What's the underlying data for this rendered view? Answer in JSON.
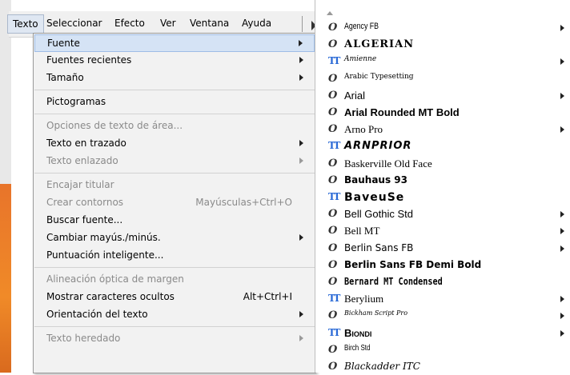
{
  "menubar": {
    "items": [
      "Texto",
      "Seleccionar",
      "Efecto",
      "Ver",
      "Ventana",
      "Ayuda"
    ]
  },
  "menu": {
    "items": [
      {
        "label": "Fuente",
        "shortcut": "",
        "submenu": true,
        "disabled": false,
        "highlight": true
      },
      {
        "label": "Fuentes recientes",
        "shortcut": "",
        "submenu": true,
        "disabled": false
      },
      {
        "label": "Tamaño",
        "shortcut": "",
        "submenu": true,
        "disabled": false
      },
      {
        "separator": true
      },
      {
        "label": "Pictogramas",
        "shortcut": "",
        "submenu": false,
        "disabled": false
      },
      {
        "separator": true
      },
      {
        "label": "Opciones de texto de área...",
        "shortcut": "",
        "submenu": false,
        "disabled": true
      },
      {
        "label": "Texto en trazado",
        "shortcut": "",
        "submenu": true,
        "disabled": false
      },
      {
        "label": "Texto enlazado",
        "shortcut": "",
        "submenu": true,
        "disabled": true
      },
      {
        "separator": true
      },
      {
        "label": "Encajar titular",
        "shortcut": "",
        "submenu": false,
        "disabled": true
      },
      {
        "label": "Crear contornos",
        "shortcut": "Mayúsculas+Ctrl+O",
        "submenu": false,
        "disabled": true
      },
      {
        "label": "Buscar fuente...",
        "shortcut": "",
        "submenu": false,
        "disabled": false
      },
      {
        "label": "Cambiar mayús./minús.",
        "shortcut": "",
        "submenu": true,
        "disabled": false
      },
      {
        "label": "Puntuación inteligente...",
        "shortcut": "",
        "submenu": false,
        "disabled": false
      },
      {
        "separator": true
      },
      {
        "label": "Alineación óptica de margen",
        "shortcut": "",
        "submenu": false,
        "disabled": true
      },
      {
        "label": "Mostrar caracteres ocultos",
        "shortcut": "Alt+Ctrl+I",
        "submenu": false,
        "disabled": false
      },
      {
        "label": "Orientación del texto",
        "shortcut": "",
        "submenu": true,
        "disabled": false
      },
      {
        "separator": true
      },
      {
        "label": "Texto heredado",
        "shortcut": "",
        "submenu": true,
        "disabled": true
      }
    ]
  },
  "fonts": [
    {
      "name": "Agency FB",
      "icon": "opentype-icon",
      "submenu": true
    },
    {
      "name": "ALGERIAN",
      "icon": "opentype-icon",
      "submenu": false
    },
    {
      "name": "Amienne",
      "icon": "truetype-icon",
      "submenu": true
    },
    {
      "name": "Arabic Typesetting",
      "icon": "opentype-icon",
      "submenu": false
    },
    {
      "name": "Arial",
      "icon": "opentype-icon",
      "submenu": true
    },
    {
      "name": "Arial Rounded MT Bold",
      "icon": "opentype-icon",
      "submenu": false
    },
    {
      "name": "Arno Pro",
      "icon": "opentype-icon",
      "submenu": true
    },
    {
      "name": "ARNPRIOR",
      "icon": "truetype-icon",
      "submenu": false
    },
    {
      "name": "Baskerville Old Face",
      "icon": "opentype-icon",
      "submenu": false
    },
    {
      "name": "Bauhaus 93",
      "icon": "opentype-icon",
      "submenu": false
    },
    {
      "name": "BaveuSe",
      "icon": "truetype-icon",
      "submenu": false
    },
    {
      "name": "Bell Gothic Std",
      "icon": "opentype-icon",
      "submenu": true
    },
    {
      "name": "Bell MT",
      "icon": "opentype-icon",
      "submenu": true
    },
    {
      "name": "Berlin Sans FB",
      "icon": "opentype-icon",
      "submenu": true
    },
    {
      "name": "Berlin Sans FB Demi Bold",
      "icon": "opentype-icon",
      "submenu": false
    },
    {
      "name": "Bernard MT Condensed",
      "icon": "opentype-icon",
      "submenu": false
    },
    {
      "name": "Berylium",
      "icon": "truetype-icon",
      "submenu": true
    },
    {
      "name": "Bickham Script Pro",
      "icon": "opentype-icon",
      "submenu": true
    },
    {
      "name": "Biondi",
      "icon": "truetype-icon",
      "submenu": true
    },
    {
      "name": "Birch Std",
      "icon": "opentype-icon",
      "submenu": false
    },
    {
      "name": "Blackadder ITC",
      "icon": "opentype-icon",
      "submenu": false
    }
  ]
}
